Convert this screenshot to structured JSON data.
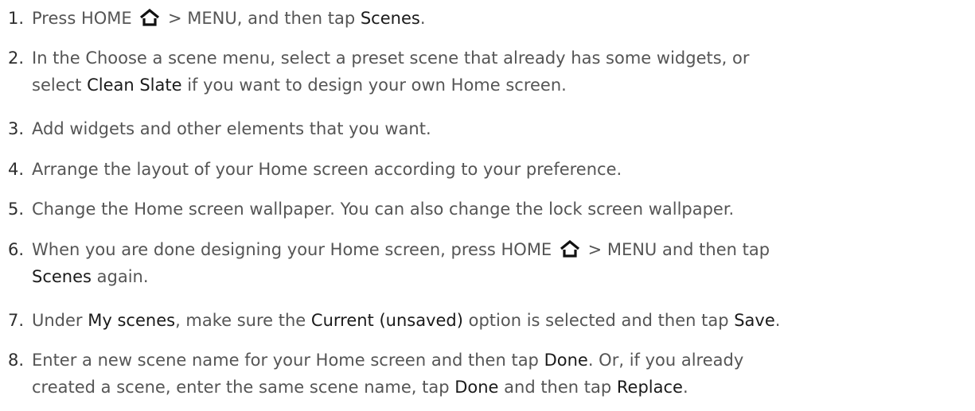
{
  "steps": [
    {
      "number": "1.",
      "lines": [
        [
          {
            "t": "Press HOME "
          },
          {
            "icon": "home-icon"
          },
          {
            "t": " > MENU, and then tap "
          },
          {
            "t": "Scenes",
            "kw": true
          },
          {
            "t": "."
          }
        ]
      ]
    },
    {
      "number": "2.",
      "lines": [
        [
          {
            "t": "In the Choose a scene menu, select a preset scene that already has some widgets, or"
          }
        ],
        [
          {
            "t": "select "
          },
          {
            "t": "Clean Slate",
            "kw": true
          },
          {
            "t": " if you want to design your own Home screen."
          }
        ]
      ]
    },
    {
      "number": "3.",
      "lines": [
        [
          {
            "t": "Add widgets and other elements that you want."
          }
        ]
      ]
    },
    {
      "number": "4.",
      "lines": [
        [
          {
            "t": "Arrange the layout of your Home screen according to your preference."
          }
        ]
      ]
    },
    {
      "number": "5.",
      "lines": [
        [
          {
            "t": "Change the Home screen wallpaper. You can also change the lock screen wallpaper."
          }
        ]
      ]
    },
    {
      "number": "6.",
      "lines": [
        [
          {
            "t": "When you are done designing your Home screen, press HOME "
          },
          {
            "icon": "home-icon"
          },
          {
            "t": " > MENU and then tap"
          }
        ],
        [
          {
            "t": "Scenes",
            "kw": true
          },
          {
            "t": " again."
          }
        ]
      ]
    },
    {
      "number": "7.",
      "lines": [
        [
          {
            "t": "Under "
          },
          {
            "t": "My scenes",
            "kw": true
          },
          {
            "t": ", make sure the "
          },
          {
            "t": "Current (unsaved)",
            "kw": true
          },
          {
            "t": " option is selected and then tap "
          },
          {
            "t": "Save",
            "kw": true
          },
          {
            "t": "."
          }
        ]
      ]
    },
    {
      "number": "8.",
      "lines": [
        [
          {
            "t": "Enter a new scene name for your Home screen and then tap "
          },
          {
            "t": "Done",
            "kw": true
          },
          {
            "t": ". Or, if you already"
          }
        ],
        [
          {
            "t": "created a scene, enter the same scene name, tap "
          },
          {
            "t": "Done",
            "kw": true
          },
          {
            "t": " and then tap "
          },
          {
            "t": "Replace",
            "kw": true
          },
          {
            "t": "."
          }
        ]
      ]
    }
  ]
}
